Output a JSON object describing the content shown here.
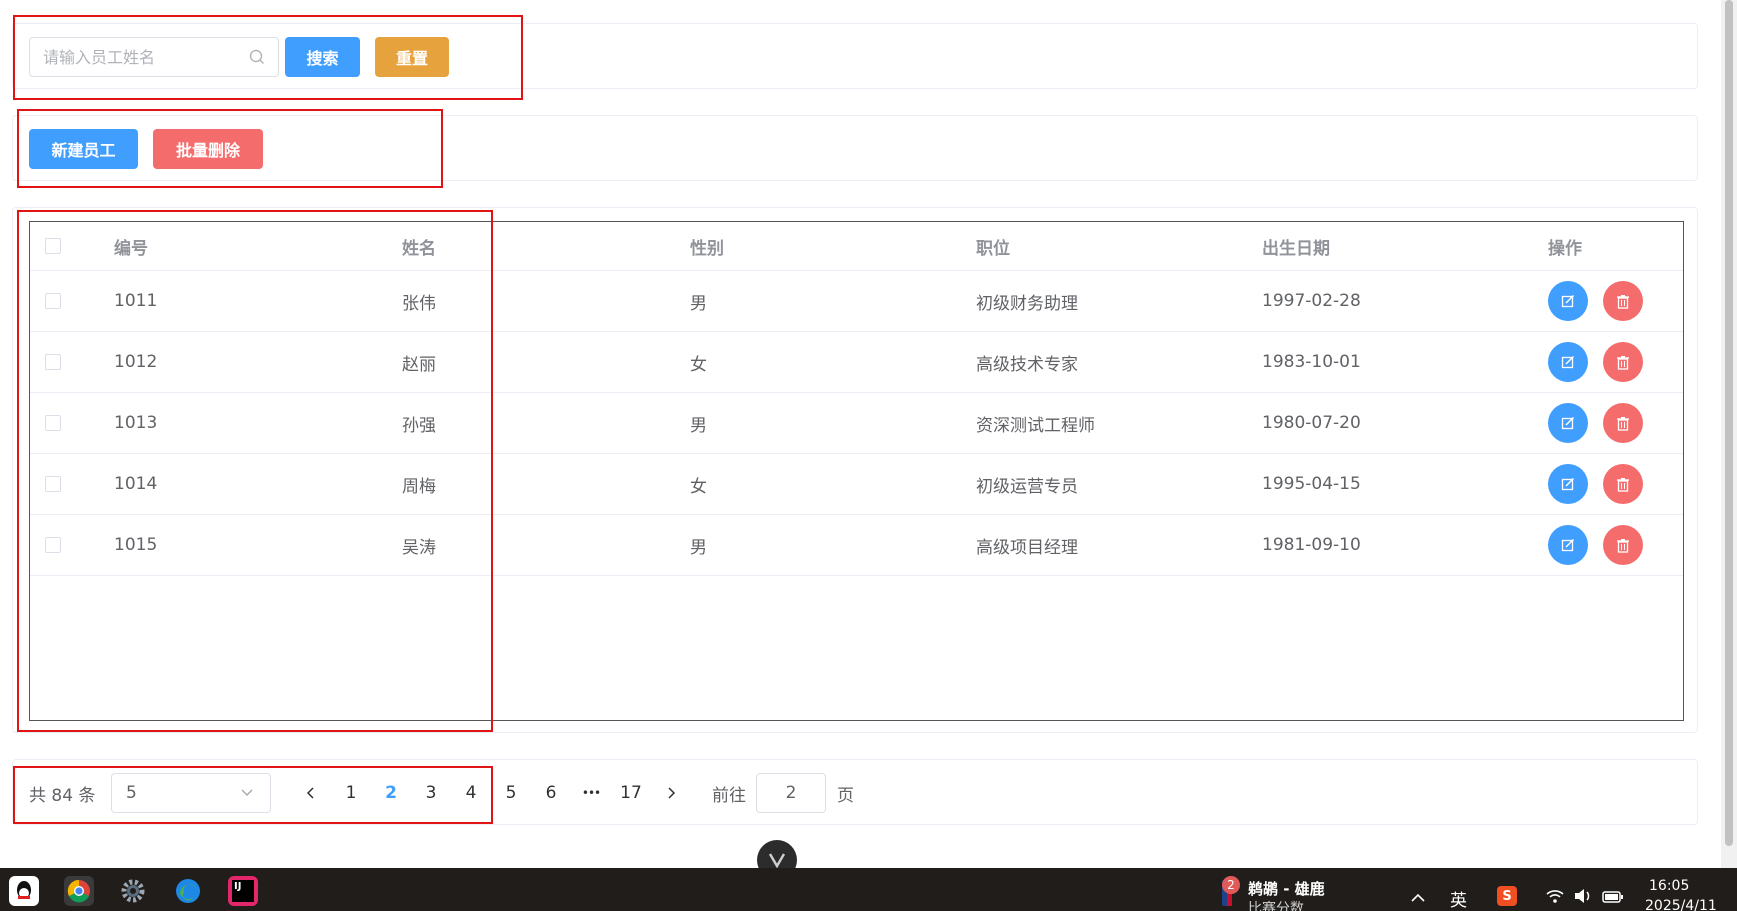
{
  "search": {
    "placeholder": "请输入员工姓名",
    "search_label": "搜索",
    "reset_label": "重置"
  },
  "actions": {
    "new_label": "新建员工",
    "batch_delete_label": "批量删除"
  },
  "table": {
    "columns": [
      "编号",
      "姓名",
      "性别",
      "职位",
      "出生日期",
      "操作"
    ],
    "rows": [
      {
        "id": "1011",
        "name": "张伟",
        "gender": "男",
        "position": "初级财务助理",
        "birth": "1997-02-28"
      },
      {
        "id": "1012",
        "name": "赵丽",
        "gender": "女",
        "position": "高级技术专家",
        "birth": "1983-10-01"
      },
      {
        "id": "1013",
        "name": "孙强",
        "gender": "男",
        "position": "资深测试工程师",
        "birth": "1980-07-20"
      },
      {
        "id": "1014",
        "name": "周梅",
        "gender": "女",
        "position": "初级运营专员",
        "birth": "1995-04-15"
      },
      {
        "id": "1015",
        "name": "吴涛",
        "gender": "男",
        "position": "高级项目经理",
        "birth": "1981-09-10"
      }
    ]
  },
  "pagination": {
    "total_label": "共 84 条",
    "page_size": "5",
    "pages": [
      "1",
      "2",
      "3",
      "4",
      "5",
      "6",
      "•••",
      "17"
    ],
    "current_page": "2",
    "goto_label": "前往",
    "goto_value": "2",
    "page_suffix": "页"
  },
  "taskbar": {
    "notification_badge": "2",
    "news_title": "鹈鹕 - 雄鹿",
    "news_subtitle": "比赛分数",
    "ime_label": "英",
    "time": "16:05",
    "date": "2025/4/11",
    "ide_label": "IJ"
  },
  "colors": {
    "primary": "#409eff",
    "warning": "#e6a23c",
    "danger": "#f56c6c",
    "annotation": "#e01414"
  }
}
